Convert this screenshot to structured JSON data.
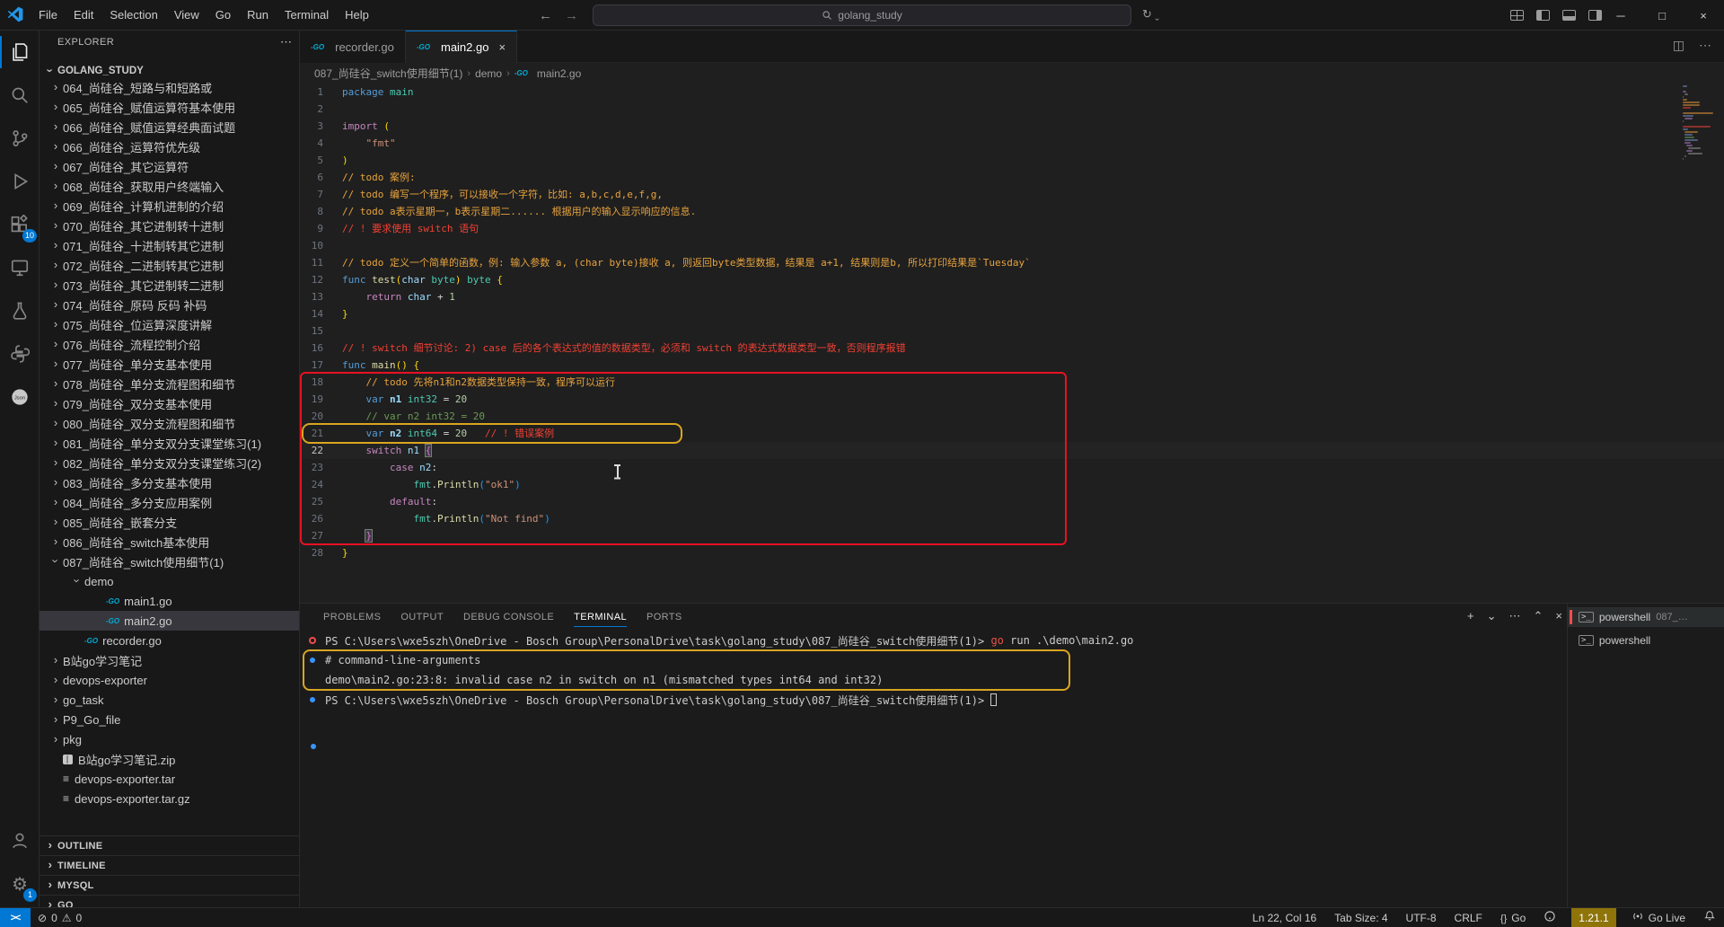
{
  "titlebar": {
    "menus": [
      "File",
      "Edit",
      "Selection",
      "View",
      "Go",
      "Run",
      "Terminal",
      "Help"
    ],
    "search_text": "golang_study",
    "window_controls": [
      {
        "name": "minimize",
        "glyph": "─"
      },
      {
        "name": "restore",
        "glyph": "□"
      },
      {
        "name": "close",
        "glyph": "×"
      }
    ]
  },
  "activity_bar": {
    "top": [
      {
        "name": "files",
        "active": true
      },
      {
        "name": "search"
      },
      {
        "name": "source-control"
      },
      {
        "name": "run-and-debug"
      },
      {
        "name": "extensions",
        "badge": "10"
      },
      {
        "name": "remote-explorer"
      },
      {
        "name": "testing"
      },
      {
        "name": "python"
      },
      {
        "name": "json"
      }
    ],
    "bottom": [
      {
        "name": "accounts"
      },
      {
        "name": "settings",
        "badge": "1"
      }
    ]
  },
  "sidebar": {
    "title": "EXPLORER",
    "more_glyph": "⋯",
    "root": "GOLANG_STUDY",
    "items": [
      {
        "label": "064_尚硅谷_短路与和短路或",
        "type": "folder",
        "depth": 1
      },
      {
        "label": "065_尚硅谷_赋值运算符基本使用",
        "type": "folder",
        "depth": 1
      },
      {
        "label": "066_尚硅谷_赋值运算经典面试题",
        "type": "folder",
        "depth": 1
      },
      {
        "label": "066_尚硅谷_运算符优先级",
        "type": "folder",
        "depth": 1
      },
      {
        "label": "067_尚硅谷_其它运算符",
        "type": "folder",
        "depth": 1
      },
      {
        "label": "068_尚硅谷_获取用户终端输入",
        "type": "folder",
        "depth": 1
      },
      {
        "label": "069_尚硅谷_计算机进制的介绍",
        "type": "folder",
        "depth": 1
      },
      {
        "label": "070_尚硅谷_其它进制转十进制",
        "type": "folder",
        "depth": 1
      },
      {
        "label": "071_尚硅谷_十进制转其它进制",
        "type": "folder",
        "depth": 1
      },
      {
        "label": "072_尚硅谷_二进制转其它进制",
        "type": "folder",
        "depth": 1
      },
      {
        "label": "073_尚硅谷_其它进制转二进制",
        "type": "folder",
        "depth": 1
      },
      {
        "label": "074_尚硅谷_原码 反码 补码",
        "type": "folder",
        "depth": 1
      },
      {
        "label": "075_尚硅谷_位运算深度讲解",
        "type": "folder",
        "depth": 1
      },
      {
        "label": "076_尚硅谷_流程控制介绍",
        "type": "folder",
        "depth": 1
      },
      {
        "label": "077_尚硅谷_单分支基本使用",
        "type": "folder",
        "depth": 1
      },
      {
        "label": "078_尚硅谷_单分支流程图和细节",
        "type": "folder",
        "depth": 1
      },
      {
        "label": "079_尚硅谷_双分支基本使用",
        "type": "folder",
        "depth": 1
      },
      {
        "label": "080_尚硅谷_双分支流程图和细节",
        "type": "folder",
        "depth": 1
      },
      {
        "label": "081_尚硅谷_单分支双分支课堂练习(1)",
        "type": "folder",
        "depth": 1
      },
      {
        "label": "082_尚硅谷_单分支双分支课堂练习(2)",
        "type": "folder",
        "depth": 1
      },
      {
        "label": "083_尚硅谷_多分支基本使用",
        "type": "folder",
        "depth": 1
      },
      {
        "label": "084_尚硅谷_多分支应用案例",
        "type": "folder",
        "depth": 1
      },
      {
        "label": "085_尚硅谷_嵌套分支",
        "type": "folder",
        "depth": 1
      },
      {
        "label": "086_尚硅谷_switch基本使用",
        "type": "folder",
        "depth": 1
      },
      {
        "label": "087_尚硅谷_switch使用细节(1)",
        "type": "folder-open",
        "depth": 1
      },
      {
        "label": "demo",
        "type": "folder-open",
        "depth": 2
      },
      {
        "label": "main1.go",
        "type": "go",
        "depth": 3
      },
      {
        "label": "main2.go",
        "type": "go",
        "depth": 3,
        "selected": true
      },
      {
        "label": "recorder.go",
        "type": "go",
        "depth": 2
      },
      {
        "label": "B站go学习笔记",
        "type": "folder",
        "depth": 1
      },
      {
        "label": "devops-exporter",
        "type": "folder",
        "depth": 1
      },
      {
        "label": "go_task",
        "type": "folder",
        "depth": 1
      },
      {
        "label": "P9_Go_file",
        "type": "folder",
        "depth": 1
      },
      {
        "label": "pkg",
        "type": "folder",
        "depth": 1
      },
      {
        "label": "B站go学习笔记.zip",
        "type": "zip",
        "depth": 1
      },
      {
        "label": "devops-exporter.tar",
        "type": "tar",
        "depth": 1
      },
      {
        "label": "devops-exporter.tar.gz",
        "type": "tar",
        "depth": 1
      }
    ],
    "sections": [
      "OUTLINE",
      "TIMELINE",
      "MYSQL",
      "GO"
    ]
  },
  "editor_tabs": [
    {
      "label": "recorder.go",
      "active": false
    },
    {
      "label": "main2.go",
      "active": true,
      "close_glyph": "×"
    }
  ],
  "breadcrumb": {
    "parts": [
      "087_尚硅谷_switch使用细节(1)",
      "demo",
      "main2.go"
    ]
  },
  "editor": {
    "active_line": 22,
    "lines": [
      {
        "n": 1,
        "ind": 0,
        "tok": [
          [
            "package",
            "kw"
          ],
          [
            " "
          ],
          [
            "main",
            "type"
          ]
        ]
      },
      {
        "n": 2,
        "ind": 0,
        "tok": []
      },
      {
        "n": 3,
        "ind": 0,
        "tok": [
          [
            "import",
            "ctl"
          ],
          [
            " "
          ],
          [
            "(",
            "b1"
          ]
        ]
      },
      {
        "n": 4,
        "ind": 1,
        "tok": [
          [
            "\"fmt\"",
            "str"
          ]
        ]
      },
      {
        "n": 5,
        "ind": 0,
        "tok": [
          [
            ")",
            "b1"
          ]
        ]
      },
      {
        "n": 6,
        "ind": 0,
        "tok": [
          [
            "// todo 案例:",
            "todo"
          ]
        ]
      },
      {
        "n": 7,
        "ind": 0,
        "tok": [
          [
            "// todo 编写一个程序，可以接收一个字符，比如: a,b,c,d,e,f,g,",
            "todo"
          ]
        ]
      },
      {
        "n": 8,
        "ind": 0,
        "tok": [
          [
            "// todo a表示星期一，b表示星期二...... 根据用户的输入显示响应的信息.",
            "todo"
          ]
        ]
      },
      {
        "n": 9,
        "ind": 0,
        "tok": [
          [
            "// ! 要求使用 switch 语句",
            "alert"
          ]
        ]
      },
      {
        "n": 10,
        "ind": 0,
        "tok": []
      },
      {
        "n": 11,
        "ind": 0,
        "tok": [
          [
            "// todo 定义一个简单的函数，例: 输入参数 a, (char byte)接收 a, 则返回byte类型数据，结果是 a+1, 结果则是b, 所以打印结果是`Tuesday`",
            "todo"
          ]
        ]
      },
      {
        "n": 12,
        "ind": 0,
        "tok": [
          [
            "func",
            "kw"
          ],
          [
            " "
          ],
          [
            "test",
            "fn"
          ],
          [
            "(",
            "b1"
          ],
          [
            "char",
            "var"
          ],
          [
            " "
          ],
          [
            "byte",
            "type"
          ],
          [
            ")",
            "b1"
          ],
          [
            " "
          ],
          [
            "byte",
            "type"
          ],
          [
            " "
          ],
          [
            "{",
            "b1"
          ]
        ]
      },
      {
        "n": 13,
        "ind": 1,
        "tok": [
          [
            "return",
            "ctl"
          ],
          [
            " "
          ],
          [
            "char",
            "var"
          ],
          [
            " + ",
            "txt"
          ],
          [
            "1",
            "num"
          ]
        ]
      },
      {
        "n": 14,
        "ind": 0,
        "tok": [
          [
            "}",
            "b1"
          ]
        ]
      },
      {
        "n": 15,
        "ind": 0,
        "tok": []
      },
      {
        "n": 16,
        "ind": 0,
        "tok": [
          [
            "// ! switch 细节讨论: 2) case 后的各个表达式的值的数据类型，必须和 switch 的表达式数据类型一致，否则程序报错",
            "alert"
          ]
        ]
      },
      {
        "n": 17,
        "ind": 0,
        "tok": [
          [
            "func",
            "kw"
          ],
          [
            " "
          ],
          [
            "main",
            "fn"
          ],
          [
            "()",
            "b1"
          ],
          [
            " "
          ],
          [
            "{",
            "b1"
          ]
        ]
      },
      {
        "n": 18,
        "ind": 1,
        "tok": [
          [
            "// todo 先将n1和n2数据类型保持一致，程序可以运行",
            "todo"
          ]
        ]
      },
      {
        "n": 19,
        "ind": 1,
        "tok": [
          [
            "var",
            "kw"
          ],
          [
            " "
          ],
          [
            "n1",
            "varb"
          ],
          [
            " "
          ],
          [
            "int32",
            "type"
          ],
          [
            " = ",
            "txt"
          ],
          [
            "20",
            "num"
          ]
        ]
      },
      {
        "n": 20,
        "ind": 1,
        "tok": [
          [
            "// var n2 int32 = 20",
            "cmt"
          ]
        ]
      },
      {
        "n": 21,
        "ind": 1,
        "tok": [
          [
            "var",
            "kw"
          ],
          [
            " "
          ],
          [
            "n2",
            "varb"
          ],
          [
            " "
          ],
          [
            "int64",
            "type"
          ],
          [
            " = ",
            "txt"
          ],
          [
            "20",
            "num"
          ],
          [
            "   ",
            "txt"
          ],
          [
            "// ! 错误案例",
            "alert"
          ]
        ]
      },
      {
        "n": 22,
        "ind": 1,
        "tok": [
          [
            "switch",
            "ctl"
          ],
          [
            " "
          ],
          [
            "n1",
            "var"
          ],
          [
            " "
          ],
          [
            "{",
            "b2m"
          ],
          [
            "",
            "caret"
          ]
        ]
      },
      {
        "n": 23,
        "ind": 2,
        "tok": [
          [
            "case",
            "ctl"
          ],
          [
            " "
          ],
          [
            "n2",
            "var"
          ],
          [
            ":",
            "txt"
          ]
        ]
      },
      {
        "n": 24,
        "ind": 3,
        "tok": [
          [
            "fmt",
            "type"
          ],
          [
            ".",
            "txt"
          ],
          [
            "Println",
            "fn"
          ],
          [
            "(",
            "b3"
          ],
          [
            "\"ok1\"",
            "str"
          ],
          [
            ")",
            "b3"
          ]
        ]
      },
      {
        "n": 25,
        "ind": 2,
        "tok": [
          [
            "default",
            "ctl"
          ],
          [
            ":",
            "txt"
          ]
        ]
      },
      {
        "n": 26,
        "ind": 3,
        "tok": [
          [
            "fmt",
            "type"
          ],
          [
            ".",
            "txt"
          ],
          [
            "Println",
            "fn"
          ],
          [
            "(",
            "b3"
          ],
          [
            "\"Not find\"",
            "str"
          ],
          [
            ")",
            "b3"
          ]
        ]
      },
      {
        "n": 27,
        "ind": 1,
        "tok": [
          [
            "}",
            "b2m"
          ]
        ]
      },
      {
        "n": 28,
        "ind": 0,
        "tok": [
          [
            "}",
            "b1"
          ]
        ]
      }
    ]
  },
  "panel": {
    "tabs": [
      "PROBLEMS",
      "OUTPUT",
      "DEBUG CONSOLE",
      "TERMINAL",
      "PORTS"
    ],
    "active_tab": "TERMINAL",
    "action_glyphs": [
      "+",
      "⌄",
      "⋯",
      "⌃",
      "×"
    ],
    "terminal_lines": [
      {
        "marker": "error",
        "tok": [
          [
            "PS C:\\Users\\wxe5szh\\OneDrive - Bosch Group\\PersonalDrive\\task\\golang_study\\087_尚硅谷_switch使用细节(1)> ",
            "ps"
          ],
          [
            "go",
            "red"
          ],
          [
            " run .\\demo\\main2.go",
            "ps"
          ]
        ]
      },
      {
        "marker": "dot",
        "tok": [
          [
            "# command-line-arguments",
            "ps"
          ]
        ]
      },
      {
        "marker": null,
        "tok": [
          [
            "demo\\main2.go:23:8: invalid case n2 in switch on n1 (mismatched types int64 and int32)",
            "ps"
          ]
        ]
      },
      {
        "marker": "dot",
        "tok": [
          [
            "PS C:\\Users\\wxe5szh\\OneDrive - Bosch Group\\PersonalDrive\\task\\golang_study\\087_尚硅谷_switch使用细节(1)> ",
            "ps"
          ],
          [
            "",
            "tcur"
          ]
        ]
      }
    ],
    "sessions": [
      {
        "label": "powershell",
        "desc": "087_…",
        "selected": true,
        "error": true
      },
      {
        "label": "powershell",
        "desc": "",
        "selected": false,
        "error": false
      }
    ]
  },
  "status_bar": {
    "remote_glyph": "><",
    "problems": {
      "error_glyph": "⊘",
      "errors": "0",
      "warn_glyph": "⚠",
      "warnings": "0"
    },
    "right": [
      {
        "label": "Ln 22, Col 16",
        "name": "cursor-position"
      },
      {
        "label": "Tab Size: 4",
        "name": "indentation"
      },
      {
        "label": "UTF-8",
        "name": "encoding"
      },
      {
        "label": "CRLF",
        "name": "eol"
      },
      {
        "label": "Go",
        "icon": "braces",
        "name": "language-mode"
      },
      {
        "icon": "github",
        "name": "github"
      },
      {
        "label": "1.21.1",
        "style": "gold",
        "name": "go-version"
      },
      {
        "label": "Go Live",
        "icon": "broadcast",
        "name": "go-live"
      },
      {
        "icon": "bell",
        "name": "notifications"
      }
    ]
  }
}
